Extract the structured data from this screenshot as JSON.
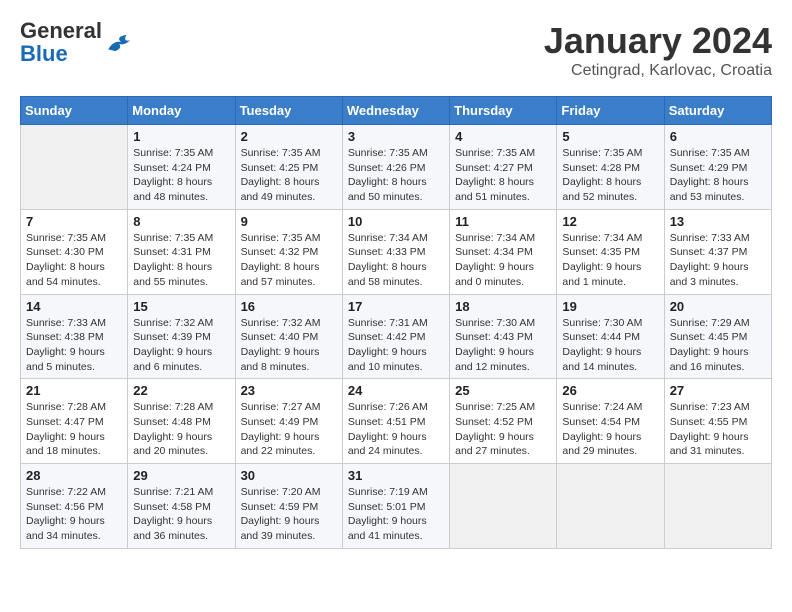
{
  "header": {
    "logo_general": "General",
    "logo_blue": "Blue",
    "month_title": "January 2024",
    "location": "Cetingrad, Karlovac, Croatia"
  },
  "weekdays": [
    "Sunday",
    "Monday",
    "Tuesday",
    "Wednesday",
    "Thursday",
    "Friday",
    "Saturday"
  ],
  "weeks": [
    [
      {
        "day": "",
        "info": ""
      },
      {
        "day": "1",
        "info": "Sunrise: 7:35 AM\nSunset: 4:24 PM\nDaylight: 8 hours\nand 48 minutes."
      },
      {
        "day": "2",
        "info": "Sunrise: 7:35 AM\nSunset: 4:25 PM\nDaylight: 8 hours\nand 49 minutes."
      },
      {
        "day": "3",
        "info": "Sunrise: 7:35 AM\nSunset: 4:26 PM\nDaylight: 8 hours\nand 50 minutes."
      },
      {
        "day": "4",
        "info": "Sunrise: 7:35 AM\nSunset: 4:27 PM\nDaylight: 8 hours\nand 51 minutes."
      },
      {
        "day": "5",
        "info": "Sunrise: 7:35 AM\nSunset: 4:28 PM\nDaylight: 8 hours\nand 52 minutes."
      },
      {
        "day": "6",
        "info": "Sunrise: 7:35 AM\nSunset: 4:29 PM\nDaylight: 8 hours\nand 53 minutes."
      }
    ],
    [
      {
        "day": "7",
        "info": "Sunrise: 7:35 AM\nSunset: 4:30 PM\nDaylight: 8 hours\nand 54 minutes."
      },
      {
        "day": "8",
        "info": "Sunrise: 7:35 AM\nSunset: 4:31 PM\nDaylight: 8 hours\nand 55 minutes."
      },
      {
        "day": "9",
        "info": "Sunrise: 7:35 AM\nSunset: 4:32 PM\nDaylight: 8 hours\nand 57 minutes."
      },
      {
        "day": "10",
        "info": "Sunrise: 7:34 AM\nSunset: 4:33 PM\nDaylight: 8 hours\nand 58 minutes."
      },
      {
        "day": "11",
        "info": "Sunrise: 7:34 AM\nSunset: 4:34 PM\nDaylight: 9 hours\nand 0 minutes."
      },
      {
        "day": "12",
        "info": "Sunrise: 7:34 AM\nSunset: 4:35 PM\nDaylight: 9 hours\nand 1 minute."
      },
      {
        "day": "13",
        "info": "Sunrise: 7:33 AM\nSunset: 4:37 PM\nDaylight: 9 hours\nand 3 minutes."
      }
    ],
    [
      {
        "day": "14",
        "info": "Sunrise: 7:33 AM\nSunset: 4:38 PM\nDaylight: 9 hours\nand 5 minutes."
      },
      {
        "day": "15",
        "info": "Sunrise: 7:32 AM\nSunset: 4:39 PM\nDaylight: 9 hours\nand 6 minutes."
      },
      {
        "day": "16",
        "info": "Sunrise: 7:32 AM\nSunset: 4:40 PM\nDaylight: 9 hours\nand 8 minutes."
      },
      {
        "day": "17",
        "info": "Sunrise: 7:31 AM\nSunset: 4:42 PM\nDaylight: 9 hours\nand 10 minutes."
      },
      {
        "day": "18",
        "info": "Sunrise: 7:30 AM\nSunset: 4:43 PM\nDaylight: 9 hours\nand 12 minutes."
      },
      {
        "day": "19",
        "info": "Sunrise: 7:30 AM\nSunset: 4:44 PM\nDaylight: 9 hours\nand 14 minutes."
      },
      {
        "day": "20",
        "info": "Sunrise: 7:29 AM\nSunset: 4:45 PM\nDaylight: 9 hours\nand 16 minutes."
      }
    ],
    [
      {
        "day": "21",
        "info": "Sunrise: 7:28 AM\nSunset: 4:47 PM\nDaylight: 9 hours\nand 18 minutes."
      },
      {
        "day": "22",
        "info": "Sunrise: 7:28 AM\nSunset: 4:48 PM\nDaylight: 9 hours\nand 20 minutes."
      },
      {
        "day": "23",
        "info": "Sunrise: 7:27 AM\nSunset: 4:49 PM\nDaylight: 9 hours\nand 22 minutes."
      },
      {
        "day": "24",
        "info": "Sunrise: 7:26 AM\nSunset: 4:51 PM\nDaylight: 9 hours\nand 24 minutes."
      },
      {
        "day": "25",
        "info": "Sunrise: 7:25 AM\nSunset: 4:52 PM\nDaylight: 9 hours\nand 27 minutes."
      },
      {
        "day": "26",
        "info": "Sunrise: 7:24 AM\nSunset: 4:54 PM\nDaylight: 9 hours\nand 29 minutes."
      },
      {
        "day": "27",
        "info": "Sunrise: 7:23 AM\nSunset: 4:55 PM\nDaylight: 9 hours\nand 31 minutes."
      }
    ],
    [
      {
        "day": "28",
        "info": "Sunrise: 7:22 AM\nSunset: 4:56 PM\nDaylight: 9 hours\nand 34 minutes."
      },
      {
        "day": "29",
        "info": "Sunrise: 7:21 AM\nSunset: 4:58 PM\nDaylight: 9 hours\nand 36 minutes."
      },
      {
        "day": "30",
        "info": "Sunrise: 7:20 AM\nSunset: 4:59 PM\nDaylight: 9 hours\nand 39 minutes."
      },
      {
        "day": "31",
        "info": "Sunrise: 7:19 AM\nSunset: 5:01 PM\nDaylight: 9 hours\nand 41 minutes."
      },
      {
        "day": "",
        "info": ""
      },
      {
        "day": "",
        "info": ""
      },
      {
        "day": "",
        "info": ""
      }
    ]
  ]
}
